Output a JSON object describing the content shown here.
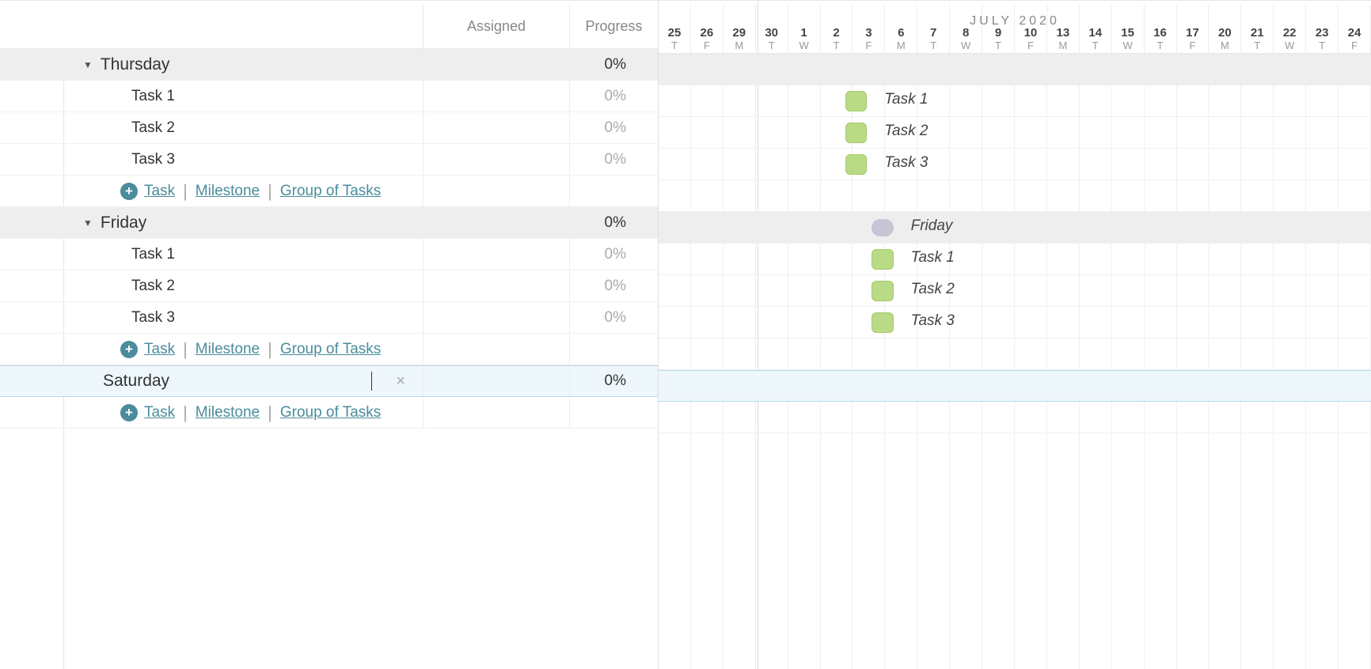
{
  "columns": {
    "assigned": "Assigned",
    "progress": "Progress"
  },
  "timeline": {
    "month_label": "JULY 2020",
    "days": [
      {
        "num": "25",
        "dow": "T"
      },
      {
        "num": "26",
        "dow": "F"
      },
      {
        "num": "29",
        "dow": "M"
      },
      {
        "num": "30",
        "dow": "T"
      },
      {
        "num": "1",
        "dow": "W"
      },
      {
        "num": "2",
        "dow": "T"
      },
      {
        "num": "3",
        "dow": "F"
      },
      {
        "num": "6",
        "dow": "M"
      },
      {
        "num": "7",
        "dow": "T"
      },
      {
        "num": "8",
        "dow": "W"
      },
      {
        "num": "9",
        "dow": "T"
      },
      {
        "num": "10",
        "dow": "F"
      },
      {
        "num": "13",
        "dow": "M"
      },
      {
        "num": "14",
        "dow": "T"
      },
      {
        "num": "15",
        "dow": "W"
      },
      {
        "num": "16",
        "dow": "T"
      },
      {
        "num": "17",
        "dow": "F"
      },
      {
        "num": "20",
        "dow": "M"
      },
      {
        "num": "21",
        "dow": "T"
      },
      {
        "num": "22",
        "dow": "W"
      },
      {
        "num": "23",
        "dow": "T"
      },
      {
        "num": "24",
        "dow": "F"
      }
    ]
  },
  "groups": [
    {
      "label": "Thursday",
      "progress": "0%",
      "tasks": [
        {
          "label": "Task 1",
          "progress": "0%",
          "bar": {
            "col": 7,
            "width": 1,
            "label": "Task 1"
          }
        },
        {
          "label": "Task 2",
          "progress": "0%",
          "bar": {
            "col": 7,
            "width": 1,
            "label": "Task 2"
          }
        },
        {
          "label": "Task 3",
          "progress": "0%",
          "bar": {
            "col": 7,
            "width": 1,
            "label": "Task 3"
          }
        }
      ],
      "milestone": null
    },
    {
      "label": "Friday",
      "progress": "0%",
      "milestone": {
        "col": 8,
        "width": 1,
        "label": "Friday"
      },
      "tasks": [
        {
          "label": "Task 1",
          "progress": "0%",
          "bar": {
            "col": 8,
            "width": 1,
            "label": "Task 1"
          }
        },
        {
          "label": "Task 2",
          "progress": "0%",
          "bar": {
            "col": 8,
            "width": 1,
            "label": "Task 2"
          }
        },
        {
          "label": "Task 3",
          "progress": "0%",
          "bar": {
            "col": 8,
            "width": 1,
            "label": "Task 3"
          }
        }
      ]
    }
  ],
  "editing_group": {
    "value": "Saturday",
    "progress": "0%"
  },
  "add_links": {
    "task": "Task",
    "milestone": "Milestone",
    "group": "Group of Tasks"
  }
}
